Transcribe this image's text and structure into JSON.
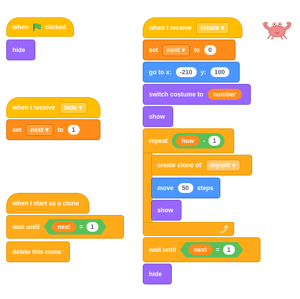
{
  "script1": {
    "hat_when": "when",
    "hat_clicked": "clicked",
    "hide": "hide"
  },
  "script2": {
    "hat": "when I receive",
    "hat_message": "hide",
    "set": "set",
    "set_var": "next",
    "set_to": "to",
    "set_value": "1"
  },
  "script3": {
    "hat": "when I start as a clone",
    "wait": "wait until",
    "wait_var": "next",
    "wait_op": "=",
    "wait_value": "1",
    "delete": "delete this clone"
  },
  "script4": {
    "hat": "when I receive",
    "hat_message": "create",
    "set": "set",
    "set_var": "next",
    "set_to": "to",
    "set_value": "0",
    "goto": "go to x:",
    "goto_x": "-210",
    "goto_y_label": "y:",
    "goto_y": "100",
    "switch": "switch costume to",
    "switch_value": "number",
    "show1": "show",
    "repeat": "repeat",
    "repeat_var": "how",
    "repeat_op": "-",
    "repeat_value": "1",
    "create_clone": "create clone of",
    "clone_target": "myself",
    "move": "move",
    "move_value": "50",
    "move_steps": "steps",
    "show2": "show",
    "wait": "wait until",
    "wait_var": "next",
    "wait_op": "=",
    "wait_value": "1",
    "hide": "hide"
  },
  "icons": {
    "flag": "green-flag-icon",
    "dropdown": "chevron-down-icon",
    "loop_arrow": "loop-arrow-icon",
    "sprite": "crab-sprite"
  },
  "colors": {
    "events": "#ffbf00",
    "control": "#ffab19",
    "variables": "#ff8c1a",
    "motion": "#4c97ff",
    "looks": "#9966ff",
    "operators": "#59c059"
  }
}
